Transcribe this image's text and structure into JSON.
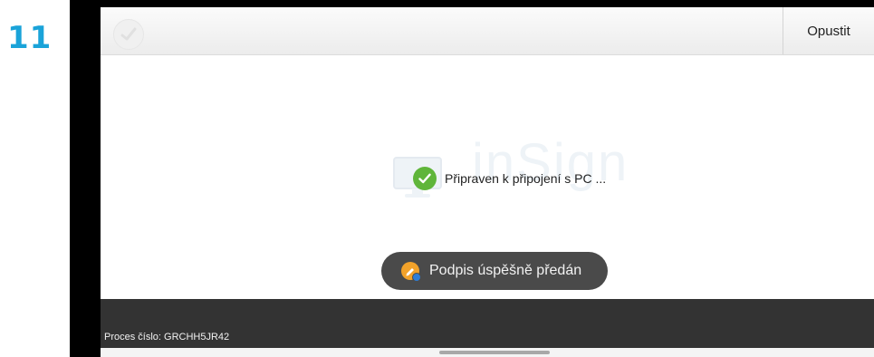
{
  "step": {
    "number": "11"
  },
  "app_bar": {
    "logo_icon": "insign-logo-icon",
    "leave_label": "Opustit"
  },
  "main": {
    "status_icon": "check-circle-icon",
    "status_text": "Připraven k připojení s PC ...",
    "watermark_icon": "monitor-icon",
    "watermark_text": "inSign"
  },
  "toast": {
    "icon": "signature-app-icon",
    "text": "Podpis úspěšně předán"
  },
  "footer": {
    "process_label": "Proces číslo: GRCHH5JR42"
  },
  "colors": {
    "step_number": "#1aa3d9",
    "check": "#5fb53a",
    "toast_bg": "#4a4a4a",
    "footer_bg": "#333333"
  }
}
